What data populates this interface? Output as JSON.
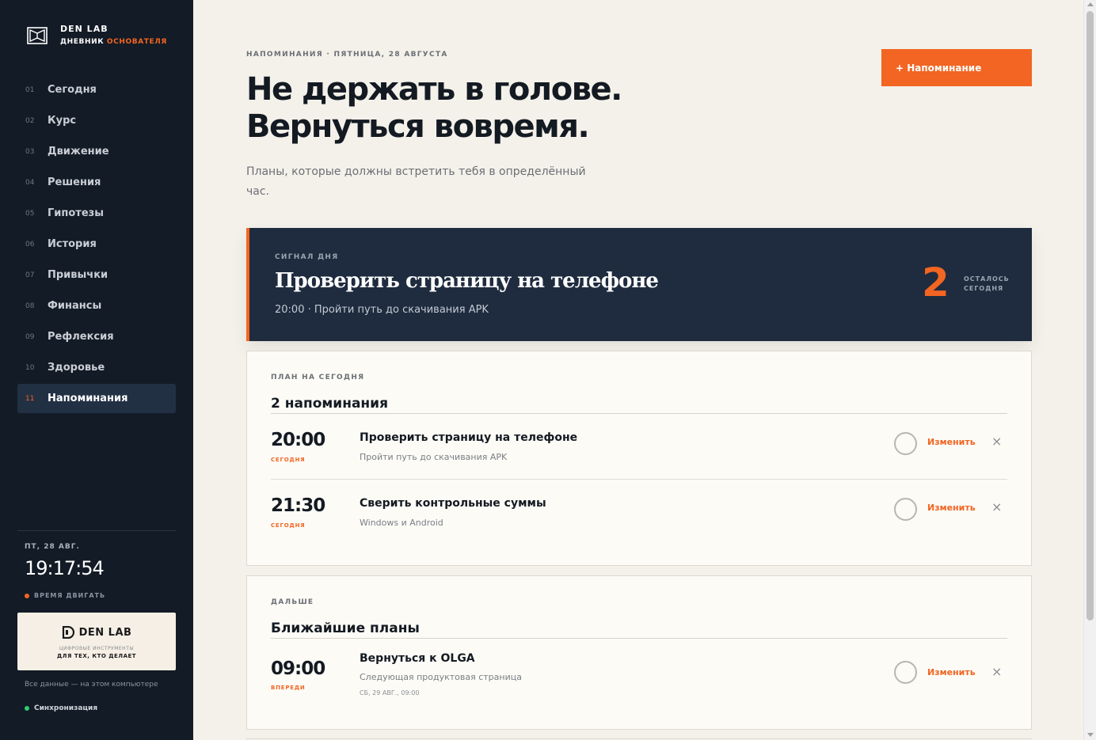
{
  "brand": {
    "name": "DEN LAB",
    "sub_prefix": "ДНЕВНИК",
    "sub_accent": "ОСНОВАТЕЛЯ"
  },
  "nav": [
    {
      "num": "01",
      "label": "Сегодня"
    },
    {
      "num": "02",
      "label": "Курс"
    },
    {
      "num": "03",
      "label": "Движение"
    },
    {
      "num": "04",
      "label": "Решения"
    },
    {
      "num": "05",
      "label": "Гипотезы"
    },
    {
      "num": "06",
      "label": "История"
    },
    {
      "num": "07",
      "label": "Привычки"
    },
    {
      "num": "08",
      "label": "Финансы"
    },
    {
      "num": "09",
      "label": "Рефлексия"
    },
    {
      "num": "10",
      "label": "Здоровье"
    },
    {
      "num": "11",
      "label": "Напоминания",
      "active": true
    }
  ],
  "clock": {
    "date": "ПТ, 28 АВГ.",
    "time": "19:17:54",
    "status": "ВРЕМЯ ДВИГАТЬ"
  },
  "promo": {
    "logo": "DEN LAB",
    "line1": "ЦИФРОВЫЕ ИНСТРУМЕНТЫ",
    "line2": "ДЛЯ ТЕХ, КТО ДЕЛАЕТ"
  },
  "data_note": "Все данные — на этом компьютере",
  "sync_label": "Синхронизация",
  "header": {
    "eyebrow": "НАПОМИНАНИЯ · ПЯТНИЦА, 28 АВГУСТА",
    "headline_line1": "Не держать в голове.",
    "headline_line2": "Вернуться вовремя.",
    "lead": "Планы, которые должны встретить тебя в определённый час.",
    "add_button": "+ Напоминание"
  },
  "signal": {
    "eyebrow": "СИГНАЛ ДНЯ",
    "title": "Проверить страницу на телефоне",
    "subtitle": "20:00 · Пройти путь до скачивания APK",
    "count": "2",
    "count_label_1": "ОСТАЛОСЬ",
    "count_label_2": "СЕГОДНЯ"
  },
  "today": {
    "eyebrow": "ПЛАН НА СЕГОДНЯ",
    "title": "2 напоминания",
    "items": [
      {
        "time": "20:00",
        "tag": "СЕГОДНЯ",
        "title": "Проверить страницу на телефоне",
        "desc": "Пройти путь до скачивания APK",
        "edit": "Изменить",
        "close": "×"
      },
      {
        "time": "21:30",
        "tag": "СЕГОДНЯ",
        "title": "Сверить контрольные суммы",
        "desc": "Windows и Android",
        "edit": "Изменить",
        "close": "×"
      }
    ]
  },
  "upcoming": {
    "eyebrow": "ДАЛЬШЕ",
    "title": "Ближайшие планы",
    "items": [
      {
        "time": "09:00",
        "tag": "ВПЕРЕДИ",
        "title": "Вернуться к OLGA",
        "desc": "Следующая продуктовая страница",
        "meta": "СБ, 29 АВГ., 09:00",
        "edit": "Изменить",
        "close": "×"
      }
    ]
  },
  "colors": {
    "accent": "#f26522",
    "sidebar_bg": "#131b26",
    "signal_bg": "#1f2c3f",
    "page_bg": "#f4f1ea",
    "sync_ok": "#2ecc71"
  }
}
